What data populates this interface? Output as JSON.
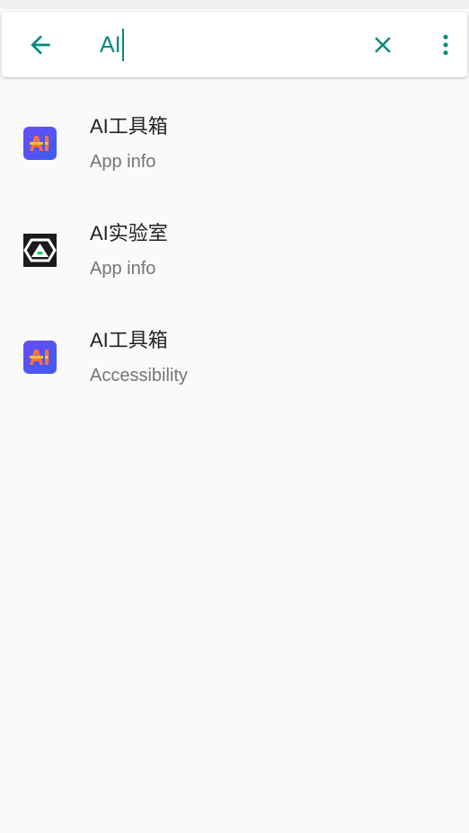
{
  "search": {
    "query": "AI",
    "back_icon": "arrow-left-icon",
    "clear_icon": "close-icon",
    "more_icon": "more-vert-icon"
  },
  "results": [
    {
      "title": "AI工具箱",
      "subtitle": "App info",
      "icon": "ai-toolbox-app-icon"
    },
    {
      "title": "AI实验室",
      "subtitle": "App info",
      "icon": "ai-lab-app-icon"
    },
    {
      "title": "AI工具箱",
      "subtitle": "Accessibility",
      "icon": "ai-toolbox-app-icon"
    }
  ],
  "colors": {
    "accent": "#00897b",
    "title_text": "#212121",
    "subtitle_text": "#757575",
    "background": "#fafafa"
  }
}
